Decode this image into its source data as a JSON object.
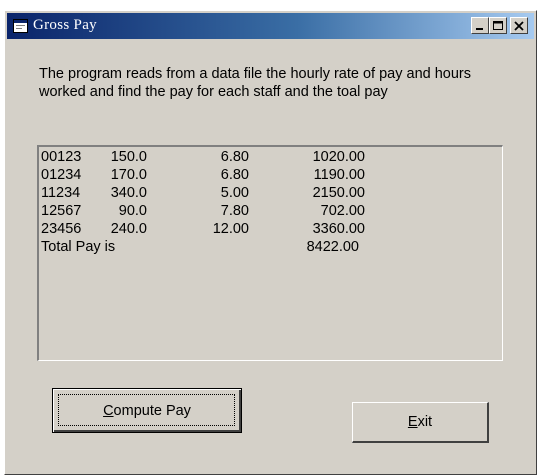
{
  "window": {
    "title": "Gross Pay"
  },
  "description": "The program reads from a data file the hourly rate of pay and hours worked and find the pay for each staff and the toal pay",
  "output": {
    "rows": [
      [
        "00123",
        "150.0",
        "6.80",
        "1020.00"
      ],
      [
        "01234",
        "170.0",
        "6.80",
        "1190.00"
      ],
      [
        "11234",
        "340.0",
        "5.00",
        "2150.00"
      ],
      [
        "12567",
        "90.0",
        "7.80",
        "702.00"
      ],
      [
        "23456",
        "240.0",
        "12.00",
        "3360.00"
      ]
    ],
    "total_label": "Total Pay is",
    "total_value": "8422.00"
  },
  "buttons": {
    "compute_first": "C",
    "compute_rest": "ompute Pay",
    "exit_first": "E",
    "exit_rest": "xit"
  },
  "icons": {
    "title_icon": "app-form-icon",
    "minimize": "minimize-icon",
    "maximize": "maximize-icon",
    "close": "close-icon"
  }
}
